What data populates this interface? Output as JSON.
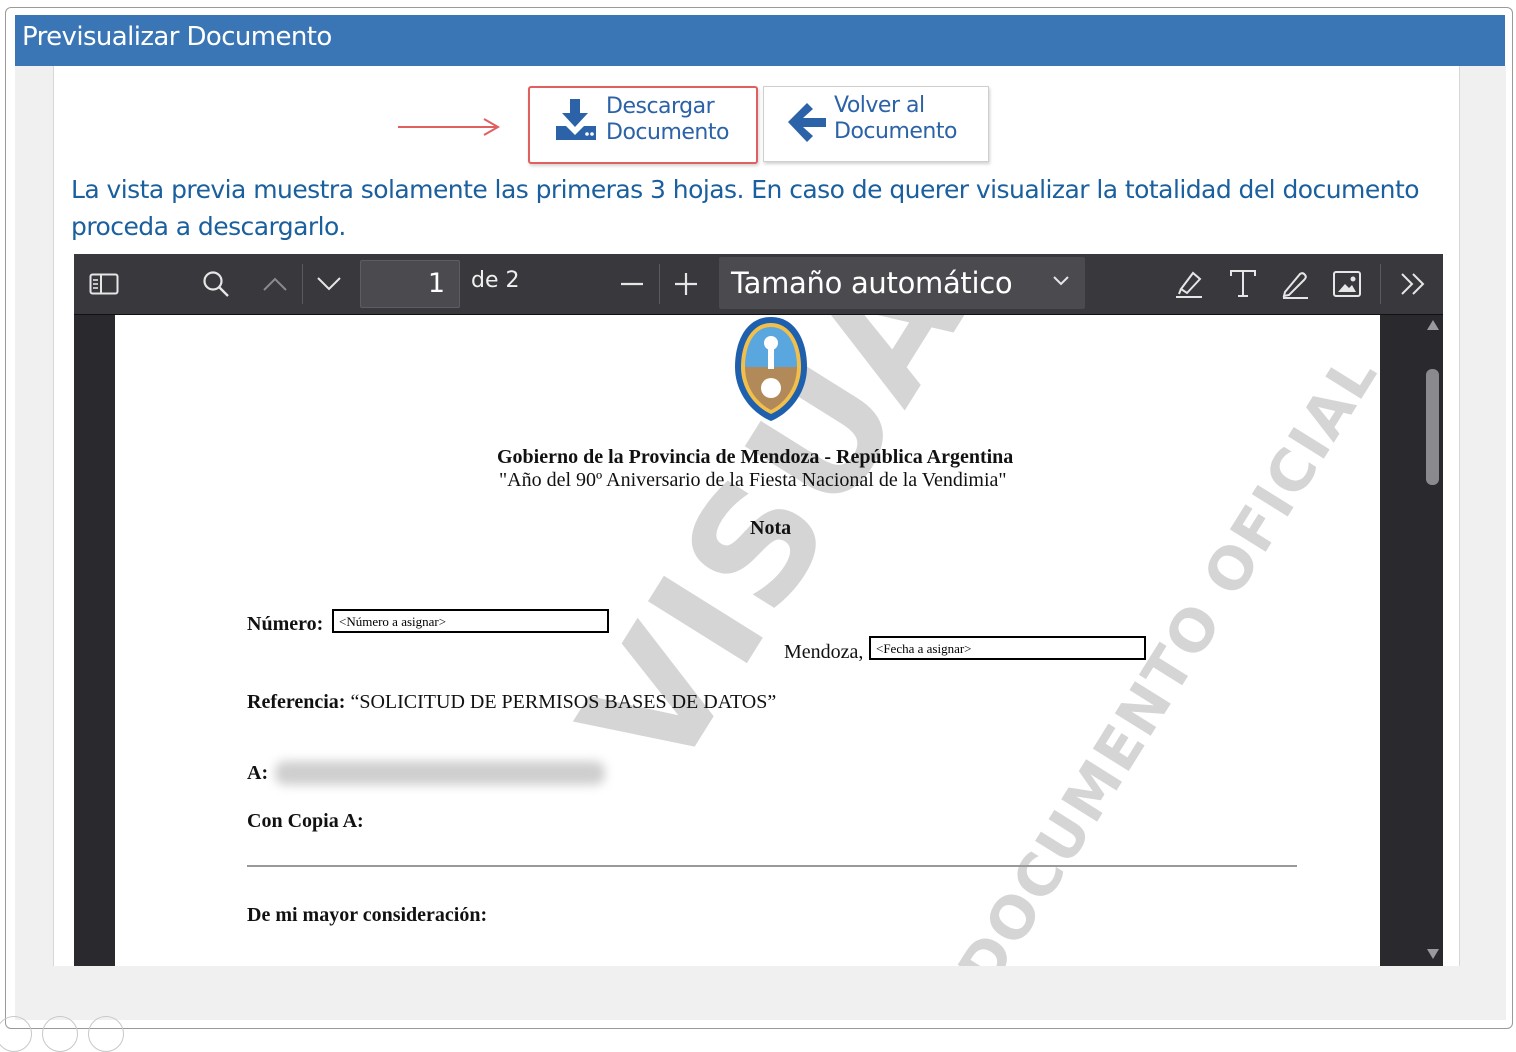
{
  "header": {
    "title": "Previsualizar Documento"
  },
  "buttons": {
    "download_line1": "Descargar",
    "download_line2": "Documento",
    "back_line1": "Volver al",
    "back_line2": "Documento"
  },
  "notice_text": "La vista previa muestra solamente las primeras 3 hojas. En caso de querer visualizar la totalidad del documento proceda a descargarlo.",
  "viewer": {
    "page_number": "1",
    "page_of": "de 2",
    "zoom": "Tamaño automático",
    "icons": [
      "sidebar-toggle-icon",
      "search-icon",
      "previous-page-icon",
      "next-page-icon",
      "zoom-out-icon",
      "zoom-in-icon",
      "highlight-icon",
      "text-icon",
      "draw-icon",
      "image-icon",
      "more-tools-icon"
    ]
  },
  "document": {
    "org_line": "Gobierno de la Provincia de Mendoza - República Argentina",
    "motto": "\"Año del 90º Aniversario de la Fiesta Nacional de la Vendimia\"",
    "doc_type": "Nota",
    "numero_label": "Número:",
    "numero_placeholder": "<Número a asignar>",
    "lugar": "Mendoza,",
    "fecha_placeholder": "<Fecha a asignar>",
    "referencia_label": "Referencia:",
    "referencia_value": "“SOLICITUD DE PERMISOS BASES DE DATOS”",
    "a_label": "A:",
    "con_copia_label": "Con Copia A:",
    "saludo": "De mi mayor consideración:",
    "watermark_main": "VISUALIZACIÓN",
    "watermark_sub": "DOCUMENTO OFICIAL"
  },
  "colors": {
    "header_bg": "#3a76b5",
    "link_blue": "#2c62a7",
    "notice_blue": "#1a5f9e",
    "highlight_red": "#e06060",
    "viewer_bg": "#38383d"
  }
}
